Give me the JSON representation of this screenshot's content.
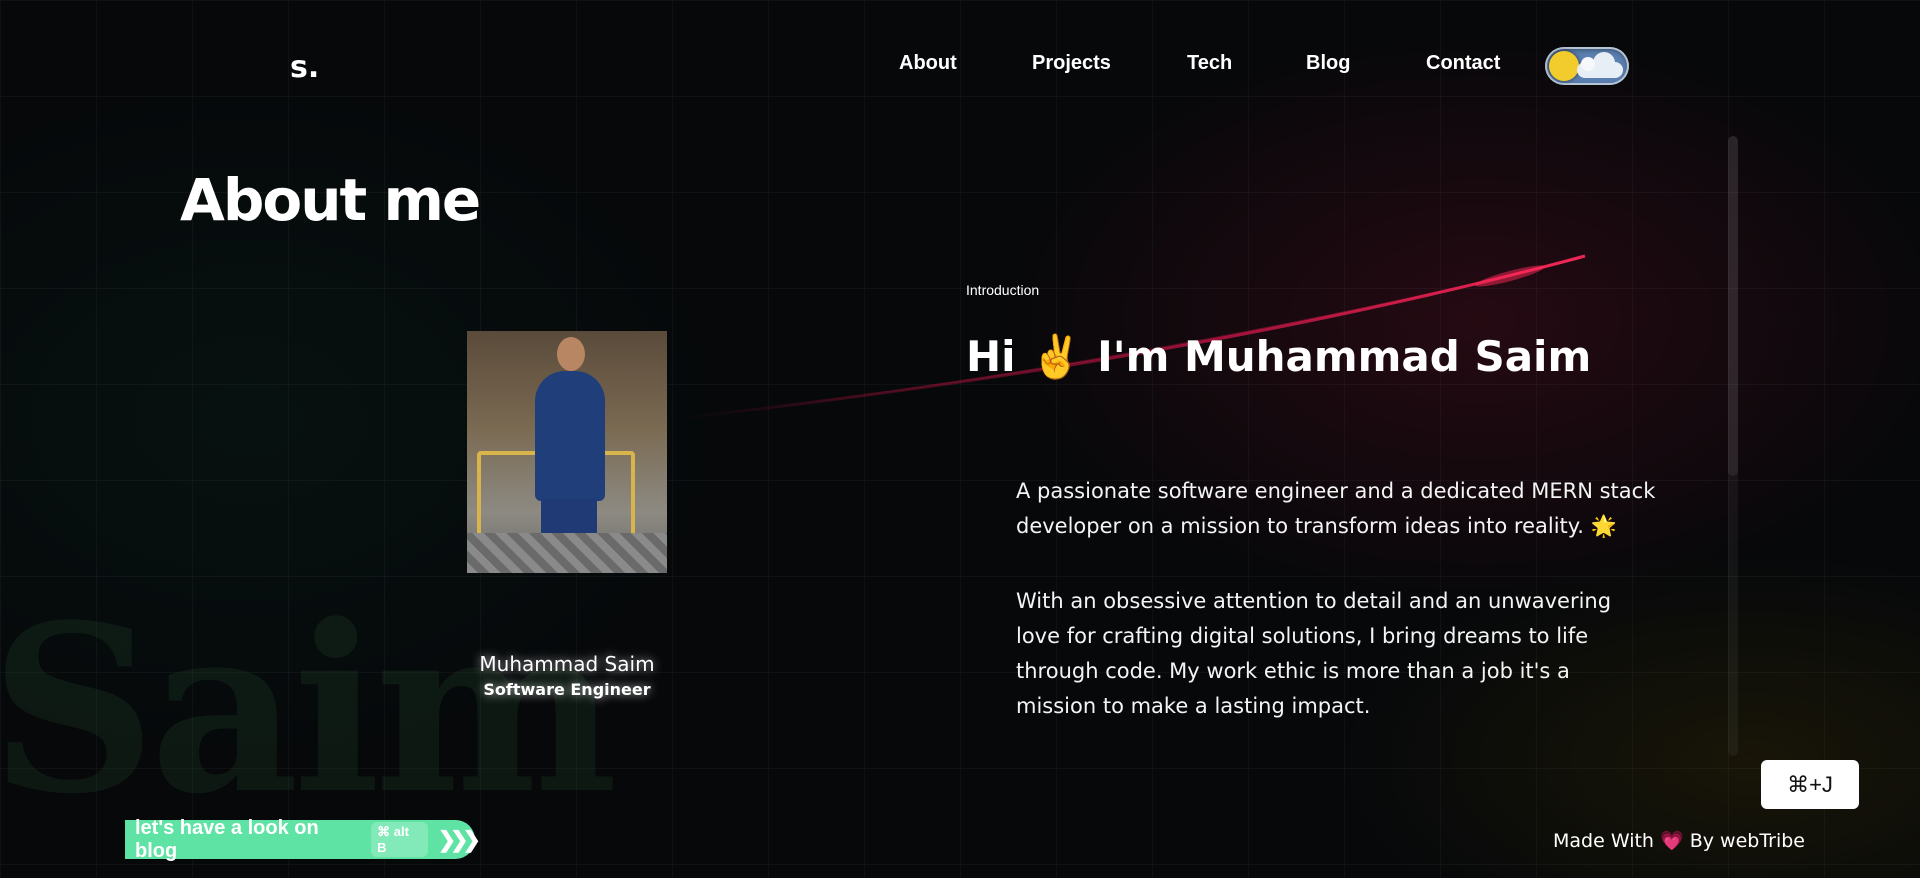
{
  "nav": {
    "logo": "s.",
    "items": [
      "About",
      "Projects",
      "Tech",
      "Blog",
      "Contact"
    ],
    "theme_toggle_icon": "sun-cloud-icon"
  },
  "about": {
    "title": "About me",
    "background_word": "Saim",
    "profile": {
      "name": "Muhammad Saim",
      "role": "Software Engineer"
    },
    "intro_label": "Introduction",
    "heading": "Hi ✌️ I'm Muhammad Saim",
    "paragraphs": [
      "A passionate software engineer and a dedicated MERN stack developer on a mission to transform ideas into reality. 🌟",
      "With an obsessive attention to detail and an unwavering love for crafting digital solutions, I bring dreams to life through code. My work ethic is more than a job it's a mission to make a lasting impact."
    ]
  },
  "blog_pill": {
    "text": "let's have a look on blog",
    "shortcut": "⌘ alt B",
    "icon": "chevrons-right-icon"
  },
  "command_button": "⌘+J",
  "footer": {
    "prefix": "Made With",
    "heart": "💗",
    "suffix": "By webTribe"
  },
  "colors": {
    "background": "#06080a",
    "accent_green": "#5fe3a4",
    "streak_red": "#d4164a",
    "toggle_blue": "#5b7fb0",
    "sun_yellow": "#f2cc2c"
  }
}
